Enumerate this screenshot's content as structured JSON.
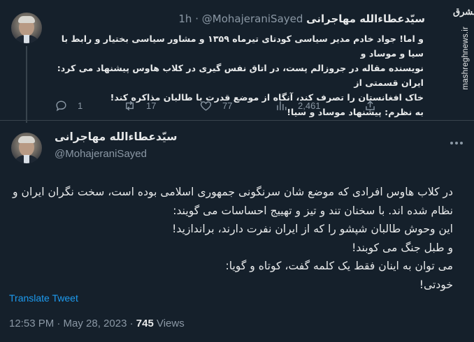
{
  "brand": {
    "logo_text": "مشرق",
    "url": "mashreghnews.ir"
  },
  "tweet1": {
    "author_name": "سیّدعطاءالله مهاجرانی",
    "handle": "@MohajeraniSayed",
    "separator": "·",
    "time": "1h",
    "lines": [
      "و اما! جواد خادم مدیر سیاسی کودتای تیرماه ۱۳۵۹ و مشاور سیاسی بختیار و رابط با سیا و موساد و",
      "نویسنده مقاله در جروزالم پست، در اتاق نفس گیری در کلاب هاوس پیشنهاد می کرد: ایران قسمتی از",
      "خاک افغانستان را تصرف کند، آنگاه از موضع قدرت با طالبان مذاکره کند!",
      "به نظرم: پیشنهاد موساد و سیا!"
    ],
    "actions": {
      "replies": "1",
      "retweets": "17",
      "likes": "77",
      "views": "2,461"
    }
  },
  "tweet2": {
    "author_name": "سیّدعطاءالله مهاجرانی",
    "handle": "@MohajeraniSayed",
    "lines": [
      "در کلاب هاوس افرادی که موضع شان سرنگونی جمهوری اسلامی بوده است، سخت نگران ایران و",
      "نظام شده اند. با  سخنان  تند و تیز و تهییج احساسات می گویند:",
      "این وحوش طالبان شپشو را که از ایران نفرت دارند، براندازید!",
      "و طبل جنگ می کوبند!",
      "می توان به اینان فقط یک کلمه گفت، کوتاه و گویا:",
      "خودتی!"
    ],
    "translate_label": "Translate Tweet",
    "timestamp": "12:53 PM · May 28, 2023 · ",
    "views_count": "745",
    "views_label": " Views"
  }
}
